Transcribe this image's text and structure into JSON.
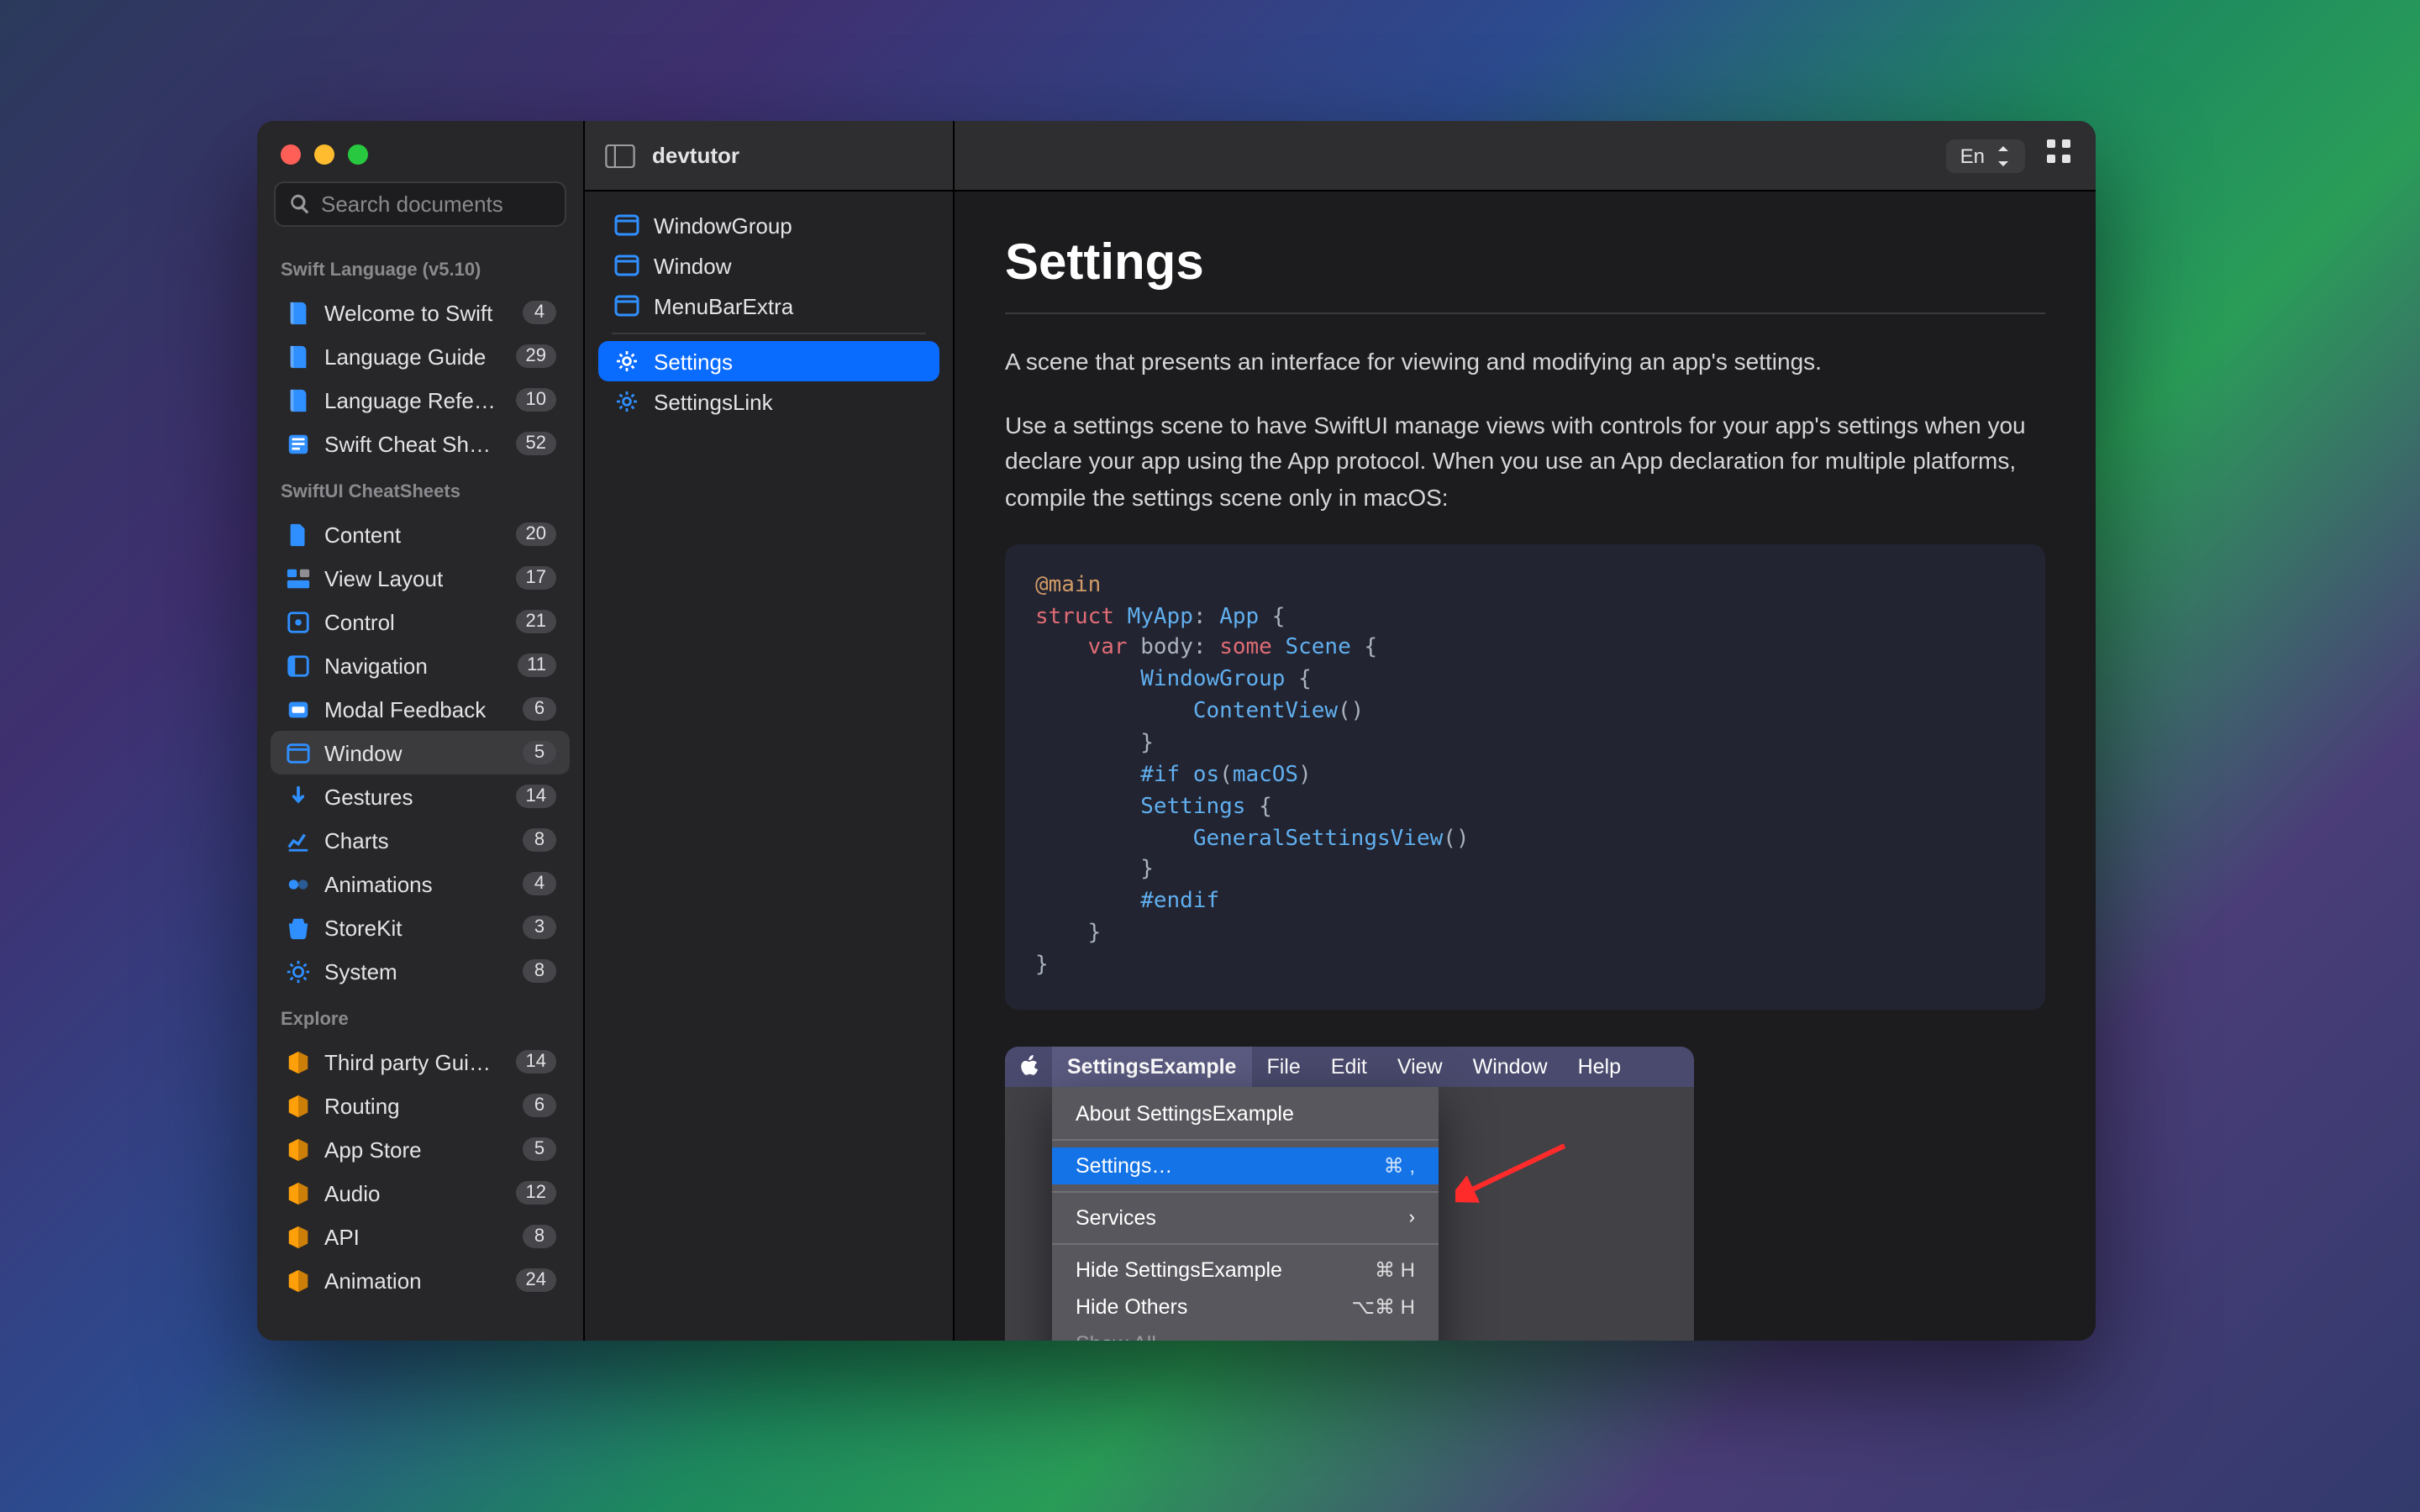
{
  "app_title": "devtutor",
  "toolbar": {
    "language_label": "En"
  },
  "search": {
    "placeholder": "Search documents"
  },
  "sidebar": {
    "sections": [
      {
        "title": "Swift Language (v5.10)",
        "items": [
          {
            "label": "Welcome to Swift",
            "badge": "4",
            "icon": "book",
            "color": "#2f8fff"
          },
          {
            "label": "Language Guide",
            "badge": "29",
            "icon": "book",
            "color": "#2f8fff"
          },
          {
            "label": "Language Refere...",
            "badge": "10",
            "icon": "book",
            "color": "#2f8fff"
          },
          {
            "label": "Swift Cheat Sheets",
            "badge": "52",
            "icon": "sheets",
            "color": "#2f8fff"
          }
        ]
      },
      {
        "title": "SwiftUI CheatSheets",
        "items": [
          {
            "label": "Content",
            "badge": "20",
            "icon": "doc",
            "color": "#2f8fff"
          },
          {
            "label": "View Layout",
            "badge": "17",
            "icon": "layout",
            "color": "#2f8fff"
          },
          {
            "label": "Control",
            "badge": "21",
            "icon": "control",
            "color": "#2f8fff"
          },
          {
            "label": "Navigation",
            "badge": "11",
            "icon": "nav",
            "color": "#2f8fff"
          },
          {
            "label": "Modal Feedback",
            "badge": "6",
            "icon": "modal",
            "color": "#2f8fff"
          },
          {
            "label": "Window",
            "badge": "5",
            "icon": "window",
            "color": "#2f8fff",
            "active": true
          },
          {
            "label": "Gestures",
            "badge": "14",
            "icon": "gesture",
            "color": "#2f8fff"
          },
          {
            "label": "Charts",
            "badge": "8",
            "icon": "chart",
            "color": "#2f8fff"
          },
          {
            "label": "Animations",
            "badge": "4",
            "icon": "anim",
            "color": "#2f8fff"
          },
          {
            "label": "StoreKit",
            "badge": "3",
            "icon": "store",
            "color": "#2f8fff"
          },
          {
            "label": "System",
            "badge": "8",
            "icon": "system",
            "color": "#2f8fff"
          }
        ]
      },
      {
        "title": "Explore",
        "items": [
          {
            "label": "Third party Guides",
            "badge": "14",
            "icon": "cube",
            "color": "#ff9f0a"
          },
          {
            "label": "Routing",
            "badge": "6",
            "icon": "cube",
            "color": "#ff9f0a"
          },
          {
            "label": "App Store",
            "badge": "5",
            "icon": "cube",
            "color": "#ff9f0a"
          },
          {
            "label": "Audio",
            "badge": "12",
            "icon": "cube",
            "color": "#ff9f0a"
          },
          {
            "label": "API",
            "badge": "8",
            "icon": "cube",
            "color": "#ff9f0a"
          },
          {
            "label": "Animation",
            "badge": "24",
            "icon": "cube",
            "color": "#ff9f0a"
          }
        ]
      }
    ]
  },
  "mid_sidebar": {
    "items": [
      {
        "label": "WindowGroup",
        "icon": "window"
      },
      {
        "label": "Window",
        "icon": "window"
      },
      {
        "label": "MenuBarExtra",
        "icon": "window"
      },
      {
        "label": "Settings",
        "icon": "gears",
        "active": true
      },
      {
        "label": "SettingsLink",
        "icon": "gears"
      }
    ]
  },
  "page": {
    "title": "Settings",
    "subtitle": "A scene that presents an interface for viewing and modifying an app's settings.",
    "body": "Use a settings scene to have SwiftUI manage views with controls for your app's settings when you declare your app using the App protocol. When you use an App declaration for multiple platforms, compile the settings scene only in macOS:",
    "code_tokens": [
      {
        "t": "@main",
        "c": "k-orange"
      },
      {
        "t": "\n"
      },
      {
        "t": "struct ",
        "c": "k-red"
      },
      {
        "t": "MyApp",
        "c": "k-blue"
      },
      {
        "t": ": ",
        "c": "k-gray"
      },
      {
        "t": "App",
        "c": "k-blue"
      },
      {
        "t": " {",
        "c": "k-gray"
      },
      {
        "t": "\n"
      },
      {
        "t": "    var ",
        "c": "k-red"
      },
      {
        "t": "body",
        "c": "k-gray"
      },
      {
        "t": ": ",
        "c": "k-gray"
      },
      {
        "t": "some ",
        "c": "k-red"
      },
      {
        "t": "Scene",
        "c": "k-blue"
      },
      {
        "t": " {",
        "c": "k-gray"
      },
      {
        "t": "\n"
      },
      {
        "t": "        WindowGroup",
        "c": "k-blue"
      },
      {
        "t": " {",
        "c": "k-gray"
      },
      {
        "t": "\n"
      },
      {
        "t": "            ContentView",
        "c": "k-blue"
      },
      {
        "t": "()",
        "c": "k-gray"
      },
      {
        "t": "\n"
      },
      {
        "t": "        }",
        "c": "k-gray"
      },
      {
        "t": "\n"
      },
      {
        "t": "        #if ",
        "c": "k-blue"
      },
      {
        "t": "os",
        "c": "k-blue"
      },
      {
        "t": "(",
        "c": "k-gray"
      },
      {
        "t": "macOS",
        "c": "k-blue"
      },
      {
        "t": ")",
        "c": "k-gray"
      },
      {
        "t": "\n"
      },
      {
        "t": "        Settings",
        "c": "k-blue"
      },
      {
        "t": " {",
        "c": "k-gray"
      },
      {
        "t": "\n"
      },
      {
        "t": "            GeneralSettingsView",
        "c": "k-blue"
      },
      {
        "t": "()",
        "c": "k-gray"
      },
      {
        "t": "\n"
      },
      {
        "t": "        }",
        "c": "k-gray"
      },
      {
        "t": "\n"
      },
      {
        "t": "        #endif",
        "c": "k-blue"
      },
      {
        "t": "\n"
      },
      {
        "t": "    }",
        "c": "k-gray"
      },
      {
        "t": "\n"
      },
      {
        "t": "}",
        "c": "k-gray"
      }
    ]
  },
  "illustration": {
    "menubar": {
      "app": "SettingsExample",
      "items": [
        "File",
        "Edit",
        "View",
        "Window",
        "Help"
      ]
    },
    "menu": [
      {
        "label": "About SettingsExample"
      },
      {
        "sep": true
      },
      {
        "label": "Settings…",
        "shortcut": "⌘ ,",
        "selected": true
      },
      {
        "sep": true
      },
      {
        "label": "Services",
        "chevron": true
      },
      {
        "sep": true
      },
      {
        "label": "Hide SettingsExample",
        "shortcut": "⌘ H"
      },
      {
        "label": "Hide Others",
        "shortcut": "⌥⌘ H"
      },
      {
        "label": "Show All",
        "dim": true
      }
    ]
  }
}
